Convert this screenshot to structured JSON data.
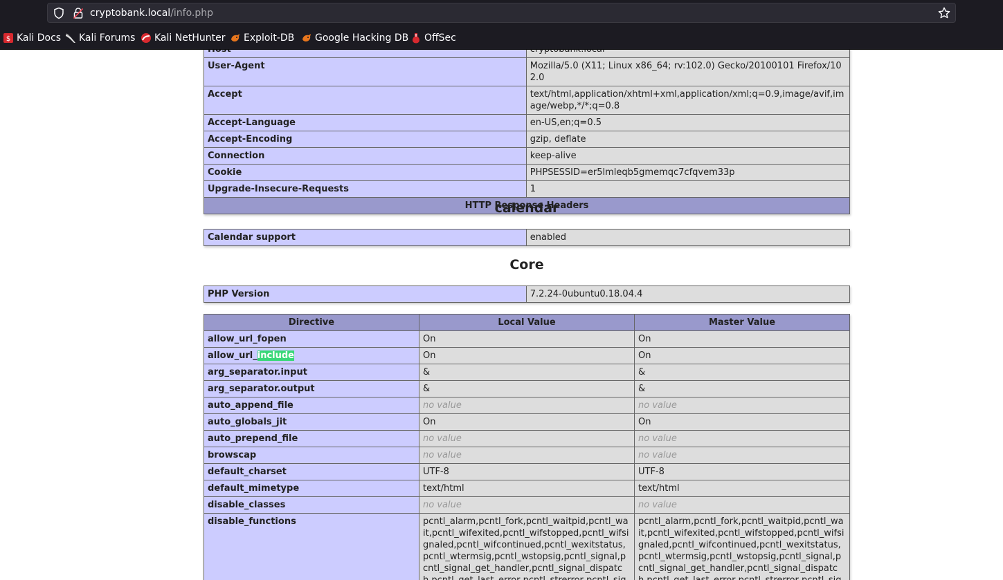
{
  "browser": {
    "url_host": "cryptobank.local",
    "url_path": "/info.php",
    "bookmarks": [
      {
        "label": "Kali Docs",
        "icon": "kali-docs-icon"
      },
      {
        "label": "Kali Forums",
        "icon": "kali-forums-icon"
      },
      {
        "label": "Kali NetHunter",
        "icon": "kali-nethunter-icon"
      },
      {
        "label": "Exploit-DB",
        "icon": "exploit-db-icon"
      },
      {
        "label": "Google Hacking DB",
        "icon": "google-hacking-db-icon"
      },
      {
        "label": "OffSec",
        "icon": "offsec-icon"
      }
    ]
  },
  "request_headers": {
    "partial_top": {
      "name": "Host",
      "value": "cryptobank.local"
    },
    "rows": [
      {
        "name": "User-Agent",
        "value": "Mozilla/5.0 (X11; Linux x86_64; rv:102.0) Gecko/20100101 Firefox/102.0"
      },
      {
        "name": "Accept",
        "value": "text/html,application/xhtml+xml,application/xml;q=0.9,image/avif,image/webp,*/*;q=0.8"
      },
      {
        "name": "Accept-Language",
        "value": "en-US,en;q=0.5"
      },
      {
        "name": "Accept-Encoding",
        "value": "gzip, deflate"
      },
      {
        "name": "Connection",
        "value": "keep-alive"
      },
      {
        "name": "Cookie",
        "value": "PHPSESSID=er5lmleqb5gmemqc7cfqvem33p"
      },
      {
        "name": "Upgrade-Insecure-Requests",
        "value": "1"
      }
    ],
    "response_header_title": "HTTP Response Headers"
  },
  "calendar": {
    "title": "calendar",
    "rows": [
      {
        "name": "Calendar support",
        "value": "enabled"
      }
    ]
  },
  "core": {
    "title": "Core",
    "php_version_label": "PHP Version",
    "php_version": "7.2.24-0ubuntu0.18.04.4",
    "directive_headers": {
      "directive": "Directive",
      "local": "Local Value",
      "master": "Master Value"
    },
    "highlight_term": "include",
    "directives": [
      {
        "name": "allow_url_fopen",
        "local": "On",
        "master": "On"
      },
      {
        "name_prefix": "allow_url_",
        "name_highlight": "include",
        "local": "On",
        "master": "On"
      },
      {
        "name": "arg_separator.input",
        "local": "&",
        "master": "&"
      },
      {
        "name": "arg_separator.output",
        "local": "&",
        "master": "&"
      },
      {
        "name": "auto_append_file",
        "local": "no value",
        "master": "no value",
        "novalue": true
      },
      {
        "name": "auto_globals_jit",
        "local": "On",
        "master": "On"
      },
      {
        "name": "auto_prepend_file",
        "local": "no value",
        "master": "no value",
        "novalue": true
      },
      {
        "name": "browscap",
        "local": "no value",
        "master": "no value",
        "novalue": true
      },
      {
        "name": "default_charset",
        "local": "UTF-8",
        "master": "UTF-8"
      },
      {
        "name": "default_mimetype",
        "local": "text/html",
        "master": "text/html"
      },
      {
        "name": "disable_classes",
        "local": "no value",
        "master": "no value",
        "novalue": true
      },
      {
        "name": "disable_functions",
        "local": "pcntl_alarm,pcntl_fork,pcntl_waitpid,pcntl_wait,pcntl_wifexited,pcntl_wifstopped,pcntl_wifsignaled,pcntl_wifcontinued,pcntl_wexitstatus,pcntl_wtermsig,pcntl_wstopsig,pcntl_signal,pcntl_signal_get_handler,pcntl_signal_dispatch,pcntl_get_last_error,pcntl_strerror,pcntl_sigprocmask,pcntl_sigwaitinf",
        "master": "pcntl_alarm,pcntl_fork,pcntl_waitpid,pcntl_wait,pcntl_wifexited,pcntl_wifstopped,pcntl_wifsignaled,pcntl_wifcontinued,pcntl_wexitstatus,pcntl_wtermsig,pcntl_wstopsig,pcntl_signal,pcntl_signal_get_handler,pcntl_signal_dispatch,pcntl_get_last_error,pcntl_strerror,pcntl_sigprocmask,pcntl_sigwaitinf"
      }
    ]
  },
  "colors": {
    "chrome_bg": "#1c1b22",
    "urlbar_bg": "#2b2a33",
    "label_cell": "#ccccff",
    "value_cell": "#dddddd",
    "header_cell": "#9999cc",
    "find_highlight": "#38d878"
  }
}
